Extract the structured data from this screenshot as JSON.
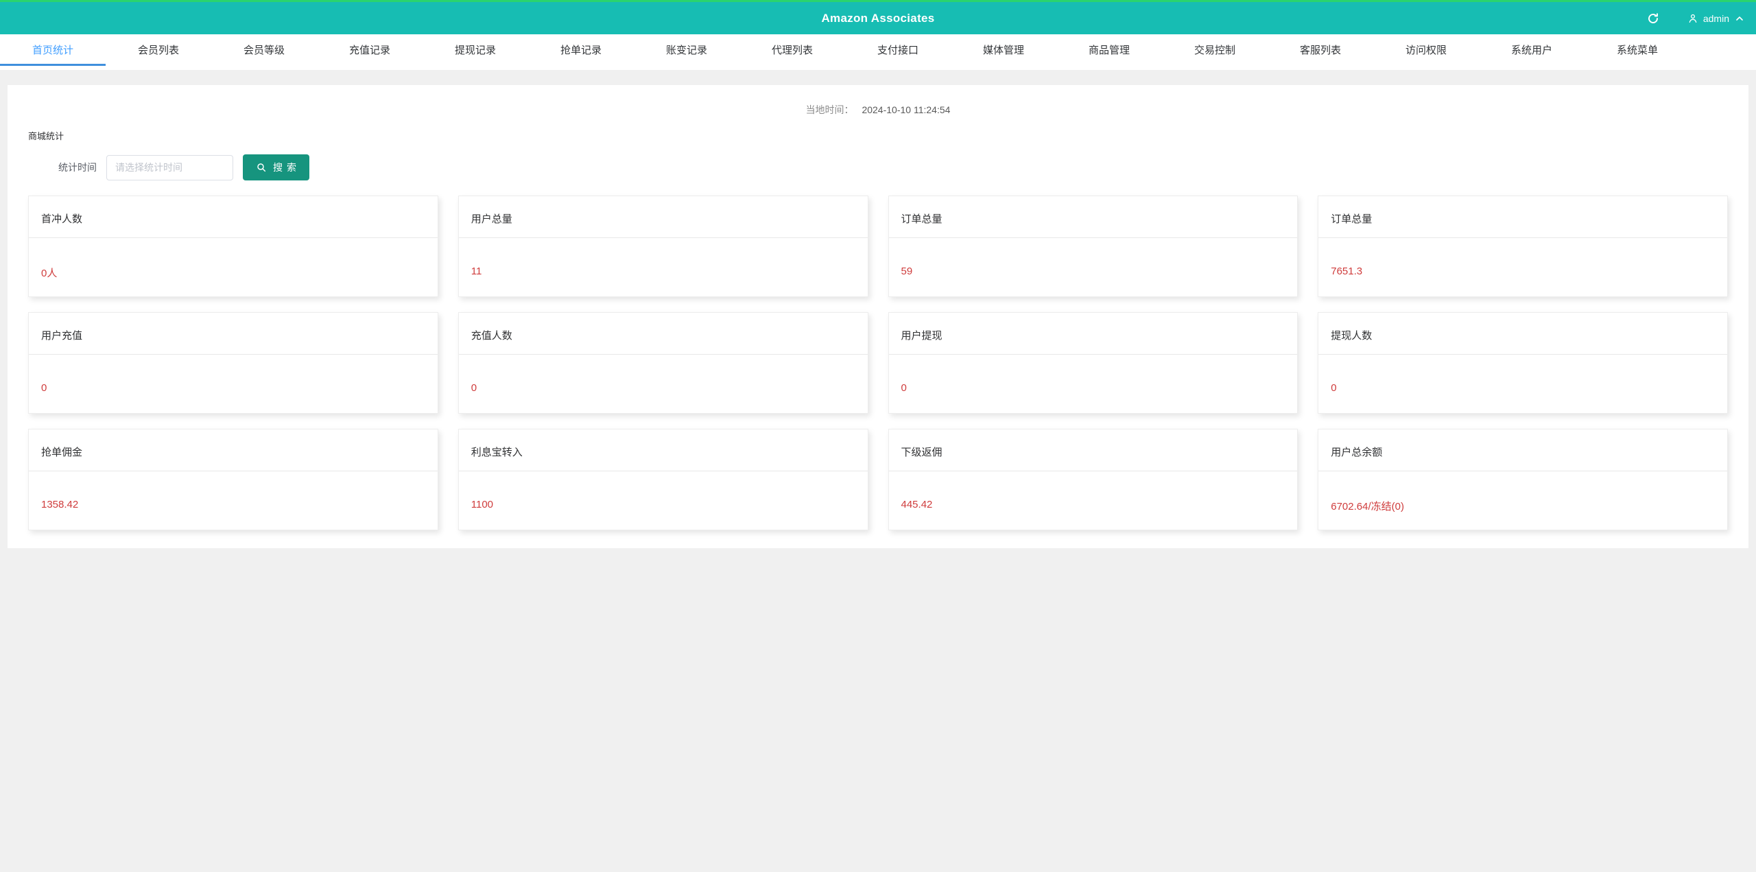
{
  "header": {
    "title": "Amazon Associates",
    "username": "admin"
  },
  "nav": {
    "tabs": [
      {
        "label": "首页统计",
        "active": true
      },
      {
        "label": "会员列表",
        "active": false
      },
      {
        "label": "会员等级",
        "active": false
      },
      {
        "label": "充值记录",
        "active": false
      },
      {
        "label": "提现记录",
        "active": false
      },
      {
        "label": "抢单记录",
        "active": false
      },
      {
        "label": "账变记录",
        "active": false
      },
      {
        "label": "代理列表",
        "active": false
      },
      {
        "label": "支付接口",
        "active": false
      },
      {
        "label": "媒体管理",
        "active": false
      },
      {
        "label": "商品管理",
        "active": false
      },
      {
        "label": "交易控制",
        "active": false
      },
      {
        "label": "客服列表",
        "active": false
      },
      {
        "label": "访问权限",
        "active": false
      },
      {
        "label": "系统用户",
        "active": false
      },
      {
        "label": "系统菜单",
        "active": false
      }
    ]
  },
  "main": {
    "local_time_label": "当地时间：",
    "local_time_value": "2024-10-10 11:24:54",
    "section_title": "商城统计",
    "filter": {
      "label": "统计时间",
      "placeholder": "请选择统计时间",
      "search_label": "搜索"
    },
    "cards": [
      {
        "title": "首冲人数",
        "value": "0人"
      },
      {
        "title": "用户总量",
        "value": "11"
      },
      {
        "title": "订单总量",
        "value": "59"
      },
      {
        "title": "订单总量",
        "value": "7651.3"
      },
      {
        "title": "用户充值",
        "value": "0"
      },
      {
        "title": "充值人数",
        "value": "0"
      },
      {
        "title": "用户提现",
        "value": "0"
      },
      {
        "title": "提现人数",
        "value": "0"
      },
      {
        "title": "抢单佣金",
        "value": "1358.42"
      },
      {
        "title": "利息宝转入",
        "value": "1100"
      },
      {
        "title": "下级返佣",
        "value": "445.42"
      },
      {
        "title": "用户总余额",
        "value": "6702.64/冻结(0)"
      }
    ]
  },
  "colors": {
    "header_teal": "#17bdb3",
    "top_accent_green": "#2bd36e",
    "active_tab_blue": "#409eff",
    "search_button_green": "#16947e",
    "stat_value_red": "#cf3c3c",
    "page_background": "#f0f0f0"
  }
}
